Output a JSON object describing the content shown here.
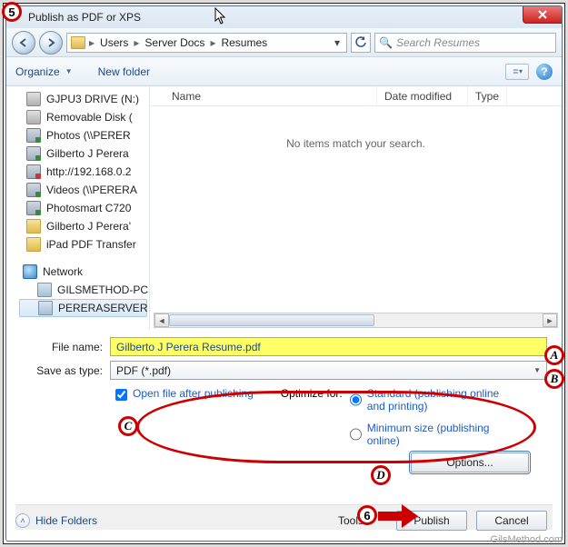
{
  "window": {
    "title": "Publish as PDF or XPS"
  },
  "nav": {
    "path": [
      "Users",
      "Server Docs",
      "Resumes"
    ],
    "search_placeholder": "Search Resumes"
  },
  "toolbar": {
    "organize": "Organize",
    "new_folder": "New folder"
  },
  "tree": {
    "items": [
      {
        "label": "GJPU3 DRIVE (N:)",
        "icon": "drive"
      },
      {
        "label": "Removable Disk (",
        "icon": "drive"
      },
      {
        "label": "Photos (\\\\PERER",
        "icon": "netdrive"
      },
      {
        "label": "Gilberto J Perera",
        "icon": "netdrive"
      },
      {
        "label": "http://192.168.0.2",
        "icon": "netdrive-err"
      },
      {
        "label": "Videos (\\\\PERERA",
        "icon": "netdrive"
      },
      {
        "label": "Photosmart C720",
        "icon": "netdrive"
      },
      {
        "label": "Gilberto J Perera'",
        "icon": "folder"
      },
      {
        "label": "iPad PDF Transfer",
        "icon": "folder"
      }
    ],
    "network_label": "Network",
    "network_items": [
      {
        "label": "GILSMETHOD-PC"
      },
      {
        "label": "PERERASERVER",
        "selected": true
      }
    ]
  },
  "columns": {
    "name": "Name",
    "date": "Date modified",
    "type": "Type"
  },
  "content": {
    "empty": "No items match your search."
  },
  "fields": {
    "file_name_label": "File name:",
    "file_name_value": "Gilberto J Perera Resume.pdf",
    "save_type_label": "Save as type:",
    "save_type_value": "PDF (*.pdf)"
  },
  "options": {
    "open_after": "Open file after publishing",
    "optimize_label": "Optimize for:",
    "standard": "Standard (publishing online and printing)",
    "minimum": "Minimum size (publishing online)",
    "options_btn": "Options..."
  },
  "footer": {
    "hide_folders": "Hide Folders",
    "tools": "Tools",
    "publish": "Publish",
    "cancel": "Cancel"
  },
  "watermark": "GilsMethod.com",
  "callouts": {
    "c5": "5",
    "c6": "6",
    "A": "A",
    "B": "B",
    "C": "C",
    "D": "D"
  }
}
